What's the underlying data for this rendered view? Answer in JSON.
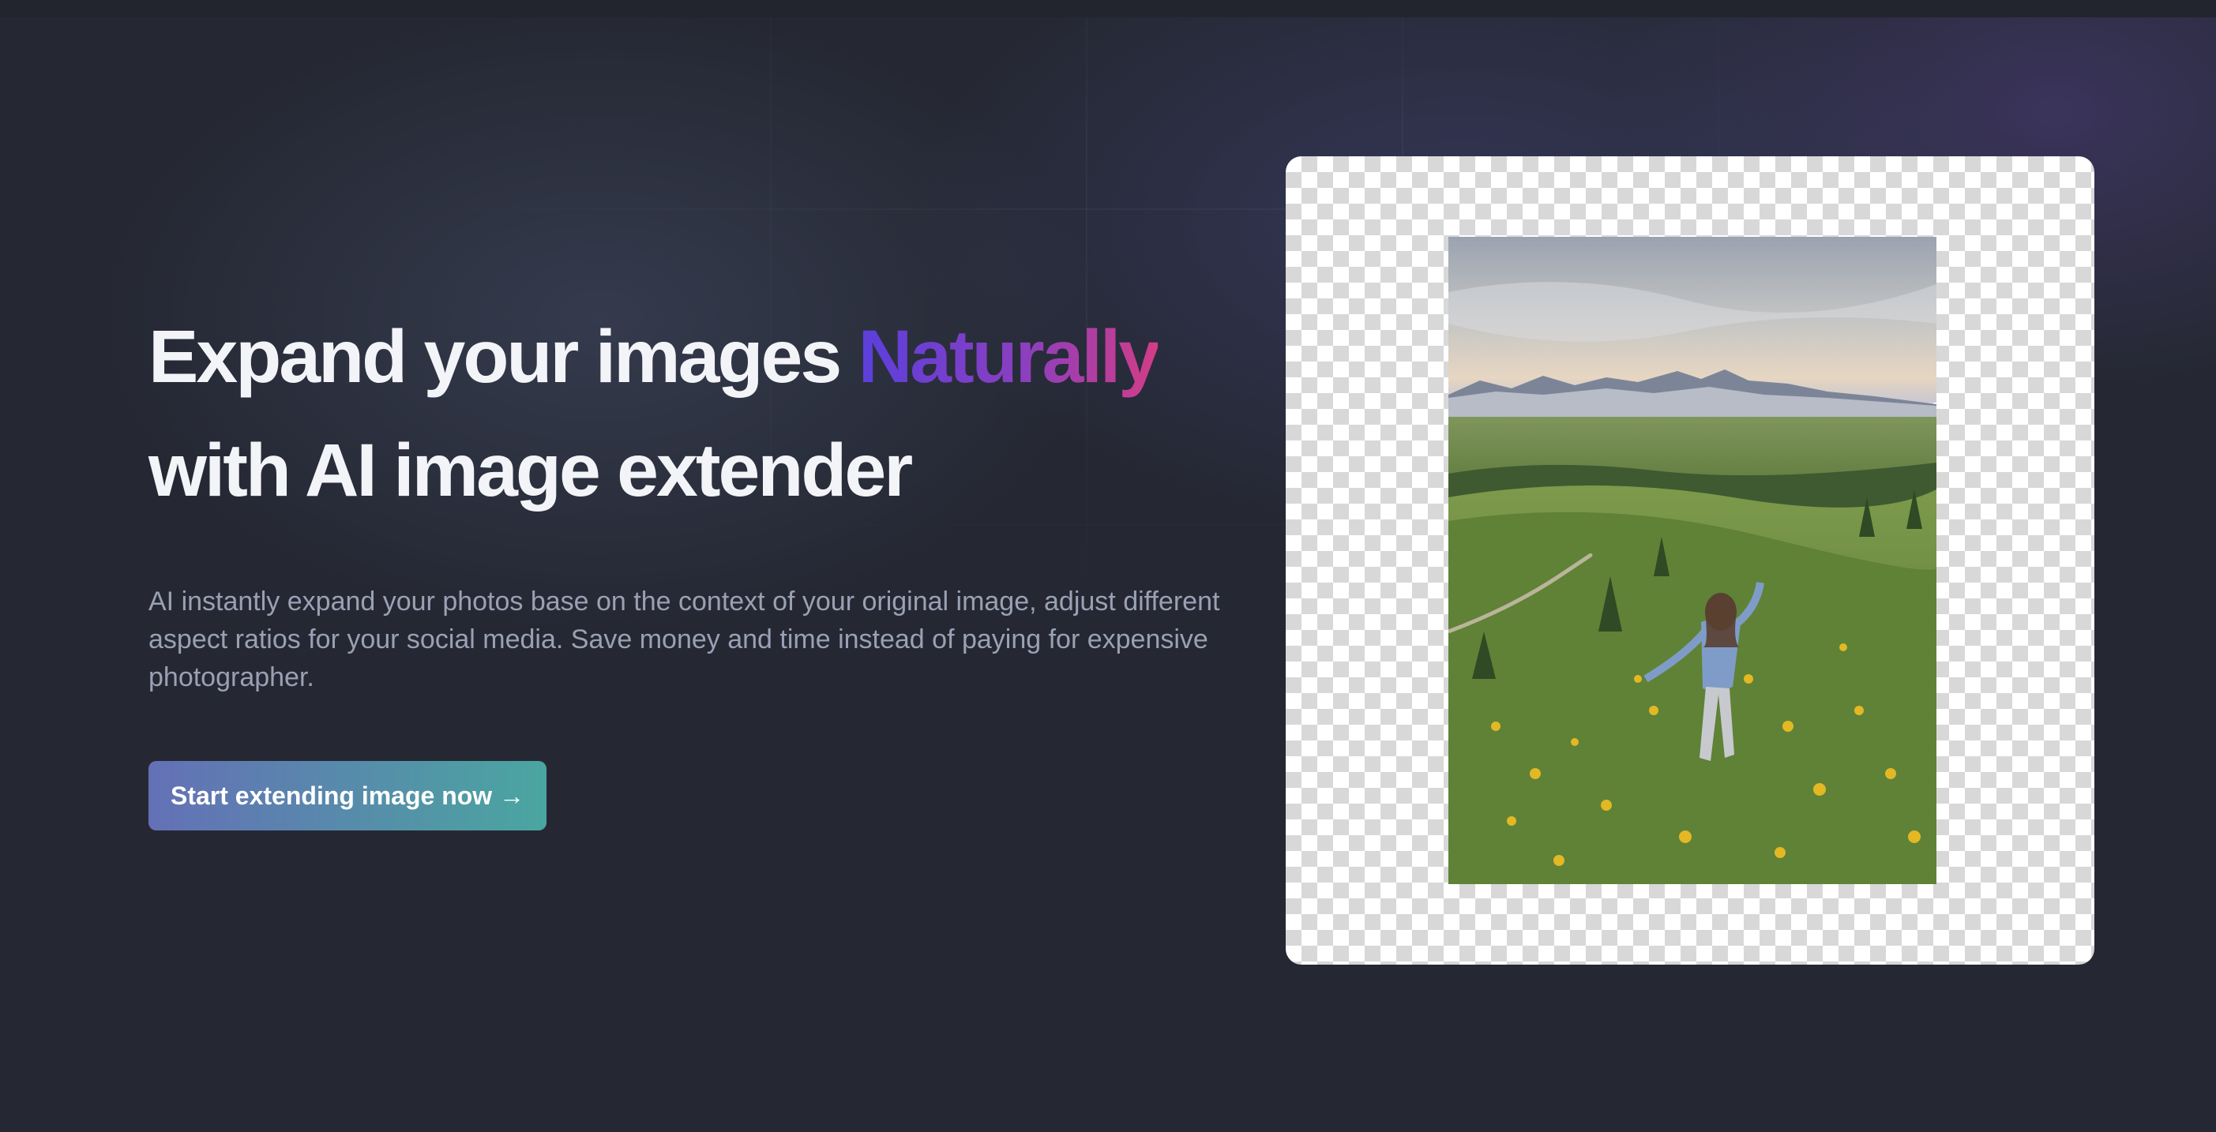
{
  "hero": {
    "headline_part1": "Expand your images ",
    "headline_accent": "Naturally",
    "headline_part2": "with AI image extender",
    "description": "AI instantly expand your photos base on the context of your original image, adjust different aspect ratios for your social media. Save money and time instead of paying for expensive photographer.",
    "cta_label": "Start extending image now →"
  },
  "colors": {
    "background": "#252833",
    "accent_gradient": [
      "#5b3fdc",
      "#d23d86"
    ],
    "cta_gradient": [
      "#6470b6",
      "#4aa6a0"
    ]
  }
}
